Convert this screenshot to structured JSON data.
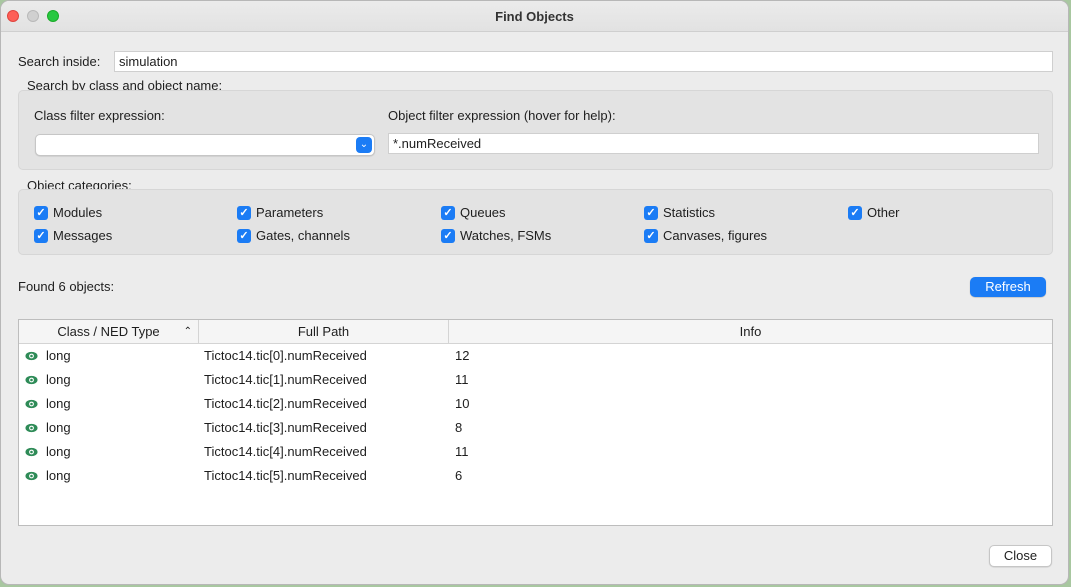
{
  "window": {
    "title": "Find Objects"
  },
  "search": {
    "label": "Search inside:",
    "value": "simulation"
  },
  "class_object": {
    "group_label": "Search by class and object name:",
    "class_filter_label": "Class filter expression:",
    "class_filter_value": "",
    "object_filter_label": "Object filter expression (hover for help):",
    "object_filter_value": "*.numReceived"
  },
  "categories": {
    "label": "Object categories:",
    "items": [
      {
        "label": "Modules",
        "checked": true
      },
      {
        "label": "Parameters",
        "checked": true
      },
      {
        "label": "Queues",
        "checked": true
      },
      {
        "label": "Statistics",
        "checked": true
      },
      {
        "label": "Other",
        "checked": true
      },
      {
        "label": "Messages",
        "checked": true
      },
      {
        "label": "Gates, channels",
        "checked": true
      },
      {
        "label": "Watches, FSMs",
        "checked": true
      },
      {
        "label": "Canvases, figures",
        "checked": true
      }
    ]
  },
  "results": {
    "found_label": "Found 6 objects:",
    "refresh_label": "Refresh",
    "columns": [
      "Class / NED Type",
      "Full Path",
      "Info"
    ],
    "rows": [
      {
        "type": "long",
        "path": "Tictoc14.tic[0].numReceived",
        "info": "12",
        "icon": "eye-icon"
      },
      {
        "type": "long",
        "path": "Tictoc14.tic[1].numReceived",
        "info": "11",
        "icon": "eye-icon"
      },
      {
        "type": "long",
        "path": "Tictoc14.tic[2].numReceived",
        "info": "10",
        "icon": "eye-icon"
      },
      {
        "type": "long",
        "path": "Tictoc14.tic[3].numReceived",
        "info": "8",
        "icon": "eye-icon"
      },
      {
        "type": "long",
        "path": "Tictoc14.tic[4].numReceived",
        "info": "11",
        "icon": "eye-icon"
      },
      {
        "type": "long",
        "path": "Tictoc14.tic[5].numReceived",
        "info": "6",
        "icon": "eye-icon"
      }
    ]
  },
  "footer": {
    "close_label": "Close"
  },
  "colors": {
    "accent": "#1b7cf5",
    "eye_icon": "#2e8b57"
  }
}
